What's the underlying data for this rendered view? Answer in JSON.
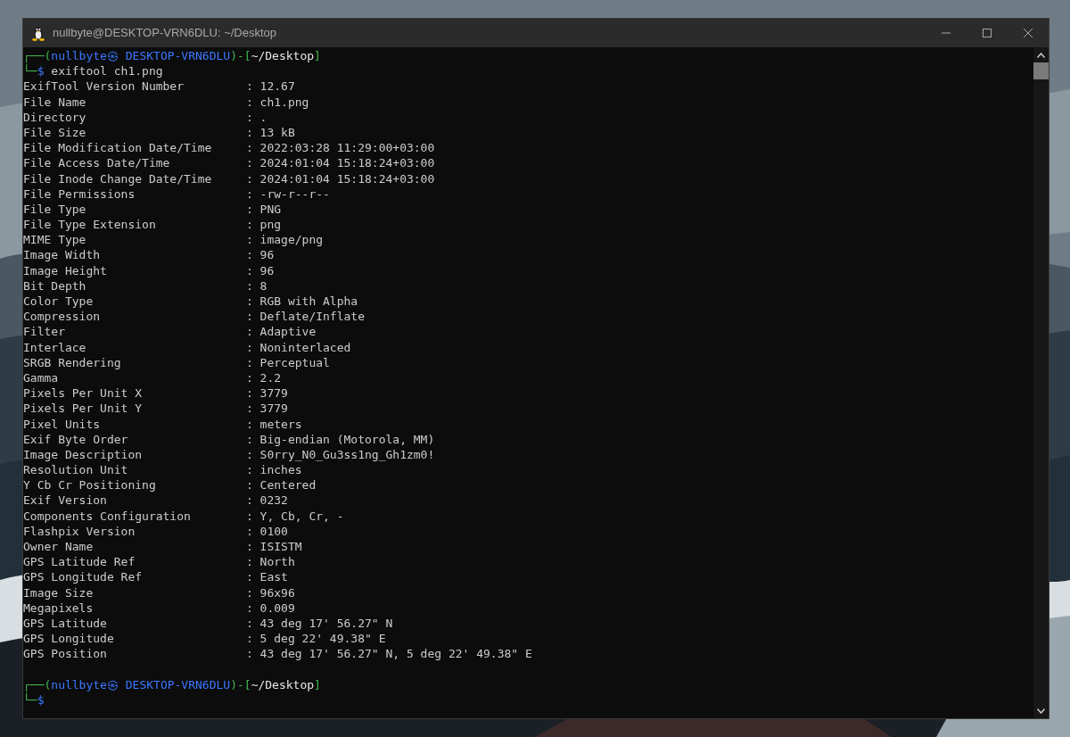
{
  "window": {
    "title": "nullbyte@DESKTOP-VRN6DLU: ~/Desktop"
  },
  "prompts": [
    {
      "open": "┌──(",
      "user_host": "nullbyte㉿ DESKTOP-VRN6DLU",
      "mid": ")-[",
      "path": "~/Desktop",
      "close": "]",
      "corner": "└─",
      "dollar": "$",
      "command": "exiftool ch1.png"
    },
    {
      "open": "┌──(",
      "user_host": "nullbyte㉿ DESKTOP-VRN6DLU",
      "mid": ")-[",
      "path": "~/Desktop",
      "close": "]",
      "corner": "└─",
      "dollar": "$"
    }
  ],
  "output": [
    {
      "key": "ExifTool Version Number",
      "sep": ":",
      "value": "12.67"
    },
    {
      "key": "File Name",
      "sep": ":",
      "value": "ch1.png"
    },
    {
      "key": "Directory",
      "sep": ":",
      "value": "."
    },
    {
      "key": "File Size",
      "sep": ":",
      "value": "13 kB"
    },
    {
      "key": "File Modification Date/Time",
      "sep": ":",
      "value": "2022:03:28 11:29:00+03:00"
    },
    {
      "key": "File Access Date/Time",
      "sep": ":",
      "value": "2024:01:04 15:18:24+03:00"
    },
    {
      "key": "File Inode Change Date/Time",
      "sep": ":",
      "value": "2024:01:04 15:18:24+03:00"
    },
    {
      "key": "File Permissions",
      "sep": ":",
      "value": "-rw-r--r--"
    },
    {
      "key": "File Type",
      "sep": ":",
      "value": "PNG"
    },
    {
      "key": "File Type Extension",
      "sep": ":",
      "value": "png"
    },
    {
      "key": "MIME Type",
      "sep": ":",
      "value": "image/png"
    },
    {
      "key": "Image Width",
      "sep": ":",
      "value": "96"
    },
    {
      "key": "Image Height",
      "sep": ":",
      "value": "96"
    },
    {
      "key": "Bit Depth",
      "sep": ":",
      "value": "8"
    },
    {
      "key": "Color Type",
      "sep": ":",
      "value": "RGB with Alpha"
    },
    {
      "key": "Compression",
      "sep": ":",
      "value": "Deflate/Inflate"
    },
    {
      "key": "Filter",
      "sep": ":",
      "value": "Adaptive"
    },
    {
      "key": "Interlace",
      "sep": ":",
      "value": "Noninterlaced"
    },
    {
      "key": "SRGB Rendering",
      "sep": ":",
      "value": "Perceptual"
    },
    {
      "key": "Gamma",
      "sep": ":",
      "value": "2.2"
    },
    {
      "key": "Pixels Per Unit X",
      "sep": ":",
      "value": "3779"
    },
    {
      "key": "Pixels Per Unit Y",
      "sep": ":",
      "value": "3779"
    },
    {
      "key": "Pixel Units",
      "sep": ":",
      "value": "meters"
    },
    {
      "key": "Exif Byte Order",
      "sep": ":",
      "value": "Big-endian (Motorola, MM)"
    },
    {
      "key": "Image Description",
      "sep": ":",
      "value": "S0rry_N0_Gu3ss1ng_Gh1zm0!"
    },
    {
      "key": "Resolution Unit",
      "sep": ":",
      "value": "inches"
    },
    {
      "key": "Y Cb Cr Positioning",
      "sep": ":",
      "value": "Centered"
    },
    {
      "key": "Exif Version",
      "sep": ":",
      "value": "0232"
    },
    {
      "key": "Components Configuration",
      "sep": ":",
      "value": "Y, Cb, Cr, -"
    },
    {
      "key": "Flashpix Version",
      "sep": ":",
      "value": "0100"
    },
    {
      "key": "Owner Name",
      "sep": ":",
      "value": "ISISTM"
    },
    {
      "key": "GPS Latitude Ref",
      "sep": ":",
      "value": "North"
    },
    {
      "key": "GPS Longitude Ref",
      "sep": ":",
      "value": "East"
    },
    {
      "key": "Image Size",
      "sep": ":",
      "value": "96x96"
    },
    {
      "key": "Megapixels",
      "sep": ":",
      "value": "0.009"
    },
    {
      "key": "GPS Latitude",
      "sep": ":",
      "value": "43 deg 17' 56.27\" N"
    },
    {
      "key": "GPS Longitude",
      "sep": ":",
      "value": "5 deg 22' 49.38\" E"
    },
    {
      "key": "GPS Position",
      "sep": ":",
      "value": "43 deg 17' 56.27\" N, 5 deg 22' 49.38\" E"
    }
  ]
}
